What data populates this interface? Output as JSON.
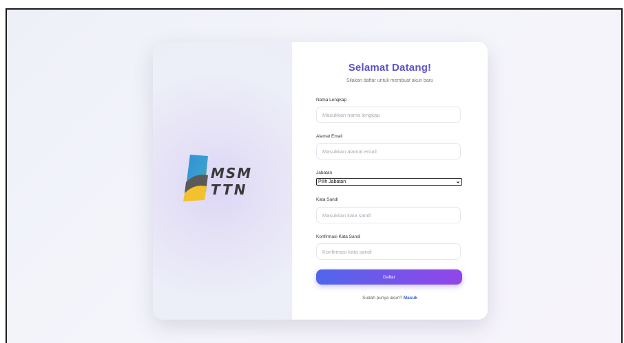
{
  "brand": {
    "logo_text_line1": "MSM",
    "logo_text_line2": "TTN"
  },
  "form": {
    "title": "Selamat Datang!",
    "subtitle": "Silakan daftar untuk membuat akun baru",
    "fields": {
      "full_name": {
        "label": "Nama Lengkap",
        "placeholder": "Masukkan nama lengkap"
      },
      "email": {
        "label": "Alamat Email",
        "placeholder": "Masukkan alamat email"
      },
      "position": {
        "label": "Jabatan",
        "selected": "Pilih Jabatan"
      },
      "password": {
        "label": "Kata Sandi",
        "placeholder": "Masukkan kata sandi"
      },
      "confirm_password": {
        "label": "Konfirmasi Kata Sandi",
        "placeholder": "Konfirmasi kata sandi"
      }
    },
    "submit_label": "Daftar",
    "footer_text": "Sudah punya akun?",
    "footer_link": "Masuk"
  },
  "colors": {
    "accent": "#5b52c9",
    "button_start": "#4f67ea",
    "button_end": "#9146ea",
    "link": "#3b5bd8",
    "logo_blue": "#2f8fd6",
    "logo_green": "#3fae4a",
    "logo_yellow": "#f2c12e",
    "logo_gray": "#5a5a5a"
  },
  "icons": {
    "select_arrow": "chevron-down-icon"
  }
}
